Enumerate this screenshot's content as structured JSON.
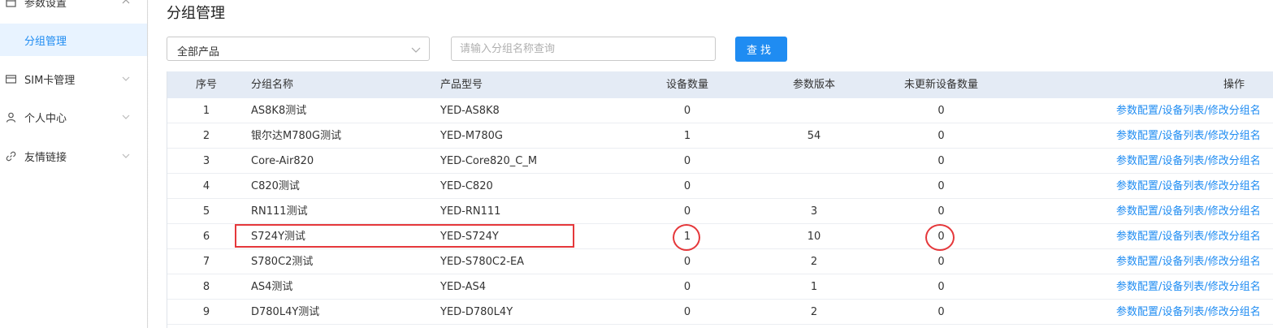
{
  "sidebar": {
    "items": [
      {
        "label": "参数设置",
        "icon": "calendar-icon"
      },
      {
        "label": "分组管理",
        "active": true
      },
      {
        "label": "SIM卡管理",
        "icon": "card-icon"
      },
      {
        "label": "个人中心",
        "icon": "user-icon"
      },
      {
        "label": "友情链接",
        "icon": "link-icon"
      }
    ]
  },
  "page": {
    "title": "分组管理"
  },
  "filter": {
    "product_select": "全部产品",
    "search_placeholder": "请输入分组名称查询",
    "search_button": "查找"
  },
  "table": {
    "headers": {
      "index": "序号",
      "group_name": "分组名称",
      "product_model": "产品型号",
      "device_count": "设备数量",
      "param_version": "参数版本",
      "not_updated": "未更新设备数量",
      "actions": "操作"
    },
    "rows": [
      {
        "index": "1",
        "name": "AS8K8测试",
        "model": "YED-AS8K8",
        "devices": "0",
        "version": "",
        "not_updated": "0",
        "ops": "参数配置/设备列表/修改分组名"
      },
      {
        "index": "2",
        "name": "银尔达M780G测试",
        "model": "YED-M780G",
        "devices": "1",
        "version": "54",
        "not_updated": "0",
        "ops": "参数配置/设备列表/修改分组名"
      },
      {
        "index": "3",
        "name": "Core-Air820",
        "model": "YED-Core820_C_M",
        "devices": "0",
        "version": "",
        "not_updated": "0",
        "ops": "参数配置/设备列表/修改分组名"
      },
      {
        "index": "4",
        "name": "C820测试",
        "model": "YED-C820",
        "devices": "0",
        "version": "",
        "not_updated": "0",
        "ops": "参数配置/设备列表/修改分组名"
      },
      {
        "index": "5",
        "name": "RN111测试",
        "model": "YED-RN111",
        "devices": "0",
        "version": "3",
        "not_updated": "0",
        "ops": "参数配置/设备列表/修改分组名"
      },
      {
        "index": "6",
        "name": "S724Y测试",
        "model": "YED-S724Y",
        "devices": "1",
        "version": "10",
        "not_updated": "0",
        "ops": "参数配置/设备列表/修改分组名"
      },
      {
        "index": "7",
        "name": "S780C2测试",
        "model": "YED-S780C2-EA",
        "devices": "0",
        "version": "2",
        "not_updated": "0",
        "ops": "参数配置/设备列表/修改分组名"
      },
      {
        "index": "8",
        "name": "AS4测试",
        "model": "YED-AS4",
        "devices": "0",
        "version": "1",
        "not_updated": "0",
        "ops": "参数配置/设备列表/修改分组名"
      },
      {
        "index": "9",
        "name": "D780L4Y测试",
        "model": "YED-D780L4Y",
        "devices": "0",
        "version": "2",
        "not_updated": "0",
        "ops": "参数配置/设备列表/修改分组名"
      }
    ]
  },
  "colors": {
    "accent": "#1f8cf2",
    "annotation": "#e5383b",
    "header_bg": "#e4ebf5"
  }
}
